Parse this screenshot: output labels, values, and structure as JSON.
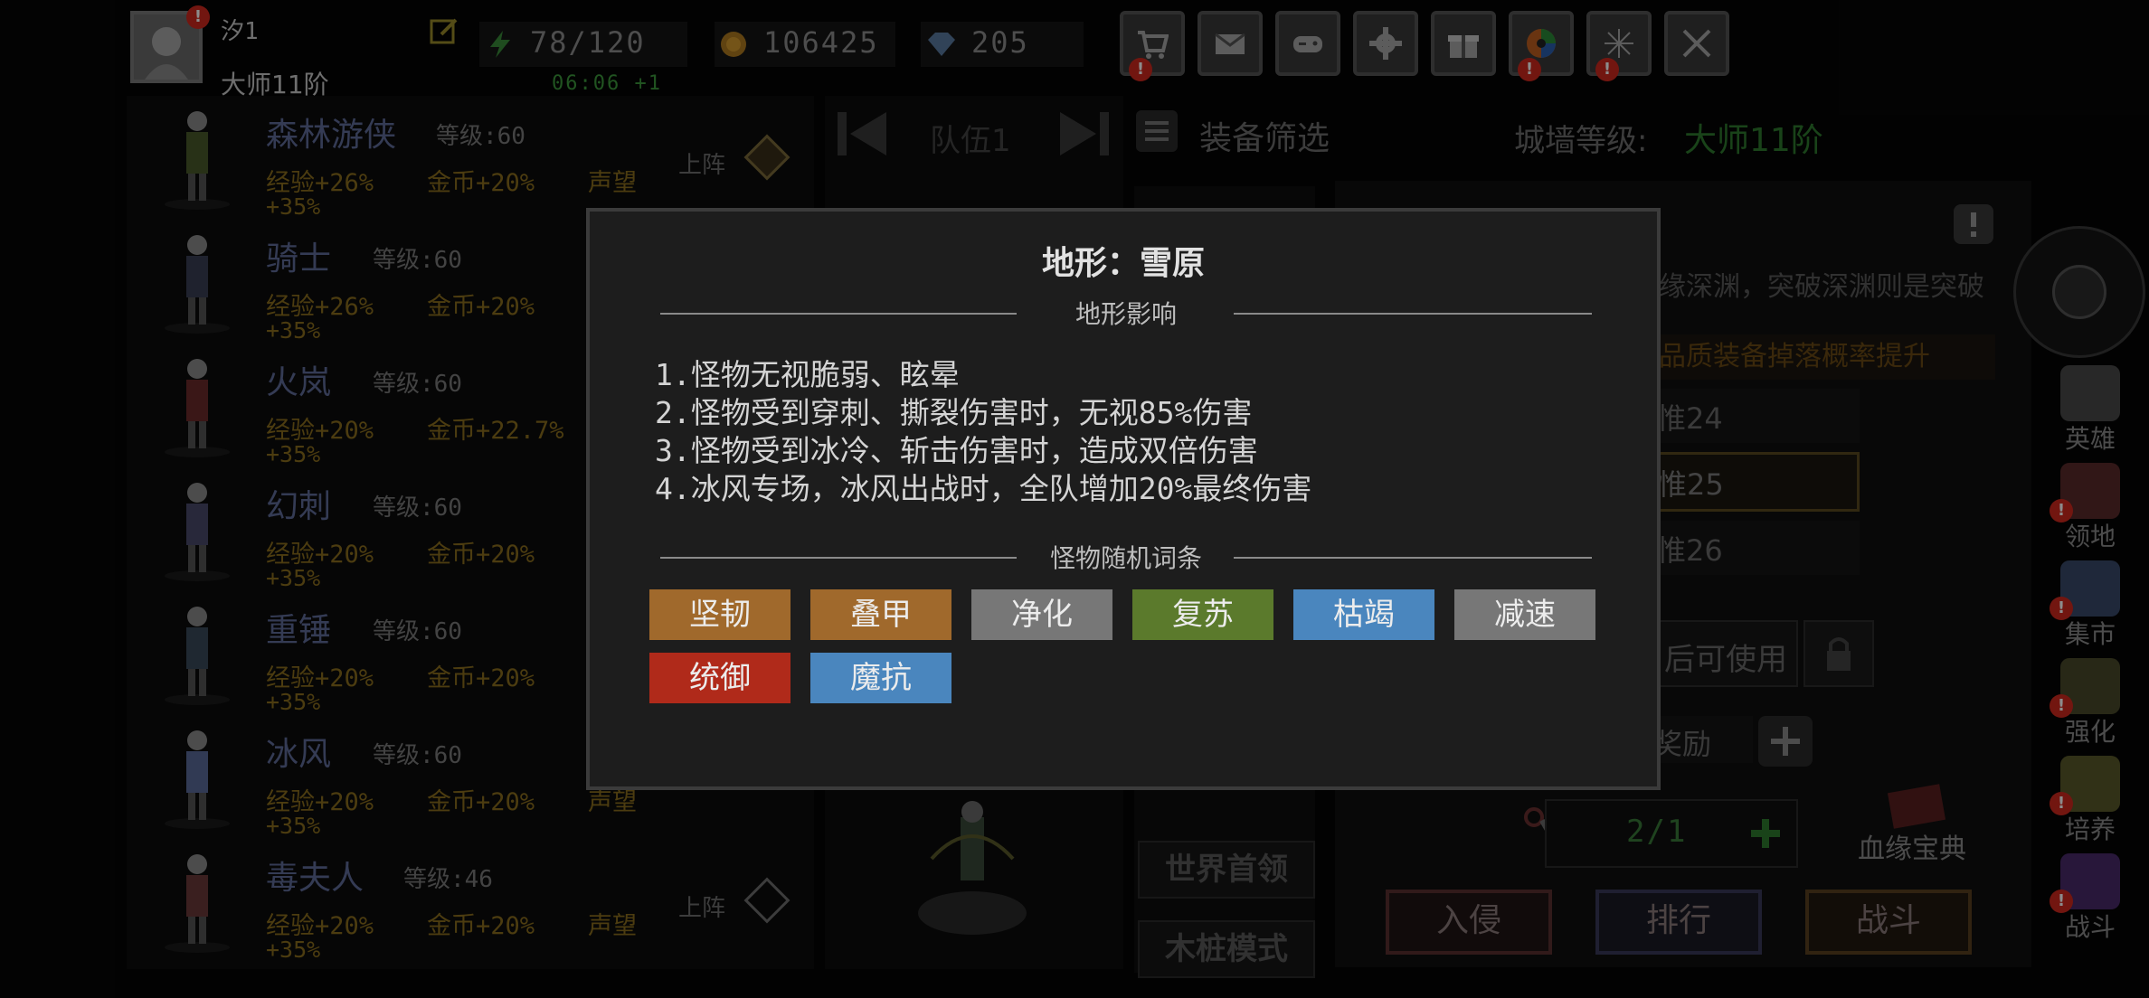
{
  "player": {
    "name": "汐1",
    "rank": "大师11阶",
    "avatar_badge": "!"
  },
  "stats": {
    "energy": "78/120",
    "gold": "106425",
    "gems": "205",
    "timer": "06:06 +1"
  },
  "top_icons": [
    {
      "name": "shop-cart-icon",
      "badge": "!"
    },
    {
      "name": "mail-icon",
      "badge": ""
    },
    {
      "name": "gamepad-icon",
      "badge": ""
    },
    {
      "name": "settings-gear-icon",
      "badge": ""
    },
    {
      "name": "gift-icon",
      "badge": ""
    },
    {
      "name": "color-wheel-icon",
      "badge": "!"
    },
    {
      "name": "fireworks-icon",
      "badge": "!"
    },
    {
      "name": "crossed-swords-icon",
      "badge": ""
    }
  ],
  "heroes": [
    {
      "name": "森林游侠",
      "level": "等级:60",
      "exp": "经验+26%",
      "gold": "金币+20%",
      "fame": "声望",
      "extra": "+35%",
      "deploy": "上阵"
    },
    {
      "name": "骑士",
      "level": "等级:60",
      "exp": "经验+26%",
      "gold": "金币+20%",
      "fame": "",
      "extra": "+35%",
      "deploy": ""
    },
    {
      "name": "火岚",
      "level": "等级:60",
      "exp": "经验+20%",
      "gold": "金币+22.7%",
      "fame": "",
      "extra": "+35%",
      "deploy": ""
    },
    {
      "name": "幻刺",
      "level": "等级:60",
      "exp": "经验+20%",
      "gold": "金币+20%",
      "fame": "",
      "extra": "+35%",
      "deploy": ""
    },
    {
      "name": "重锤",
      "level": "等级:60",
      "exp": "经验+20%",
      "gold": "金币+20%",
      "fame": "",
      "extra": "+35%",
      "deploy": ""
    },
    {
      "name": "冰风",
      "level": "等级:60",
      "exp": "经验+20%",
      "gold": "金币+20%",
      "fame": "声望",
      "extra": "+35%",
      "deploy": ""
    },
    {
      "name": "毒夫人",
      "level": "等级:46",
      "exp": "经验+20%",
      "gold": "金币+20%",
      "fame": "声望",
      "extra": "+35%",
      "deploy": "上阵"
    }
  ],
  "team": {
    "label": "队伍1"
  },
  "equip_filter": "装备筛选",
  "wall": {
    "label": "城墙等级:",
    "value": "大师11阶"
  },
  "right_bg": {
    "abyss_text": "缘深渊，突破深渊则是突破",
    "drop_text": "品质装备掉落概率提升",
    "tiers": [
      "惟24",
      "惟25",
      "惟26"
    ],
    "unlock_text": "后可使用",
    "reward_text": "奖励",
    "count": "2/1",
    "codex": "血缘宝典",
    "modes": [
      "世界首领",
      "木桩模式"
    ],
    "actions": [
      "入侵",
      "排行",
      "战斗"
    ]
  },
  "side_nav": [
    {
      "name": "heroes",
      "label": "英雄",
      "badge": ""
    },
    {
      "name": "territory",
      "label": "领地",
      "badge": "!"
    },
    {
      "name": "market",
      "label": "集市",
      "badge": "!"
    },
    {
      "name": "enhance",
      "label": "强化",
      "badge": "!"
    },
    {
      "name": "cultivate",
      "label": "培养",
      "badge": "!"
    },
    {
      "name": "battle",
      "label": "战斗",
      "badge": "!"
    }
  ],
  "modal": {
    "title": "地形：雪原",
    "section_effects": "地形影响",
    "effects": [
      "1.怪物无视脆弱、眩晕",
      "2.怪物受到穿刺、撕裂伤害时，无视85%伤害",
      "3.怪物受到冰冷、斩击伤害时，造成双倍伤害",
      "4.冰风专场，冰风出战时，全队增加20%最终伤害"
    ],
    "section_affixes": "怪物随机词条",
    "affixes": [
      {
        "label": "坚韧",
        "color": "#a0692c"
      },
      {
        "label": "叠甲",
        "color": "#a0692c"
      },
      {
        "label": "净化",
        "color": "#777777"
      },
      {
        "label": "复苏",
        "color": "#5b7a2c"
      },
      {
        "label": "枯竭",
        "color": "#4a86be"
      },
      {
        "label": "减速",
        "color": "#777777"
      },
      {
        "label": "统御",
        "color": "#b02a1a"
      },
      {
        "label": "魔抗",
        "color": "#4a86be"
      }
    ]
  }
}
